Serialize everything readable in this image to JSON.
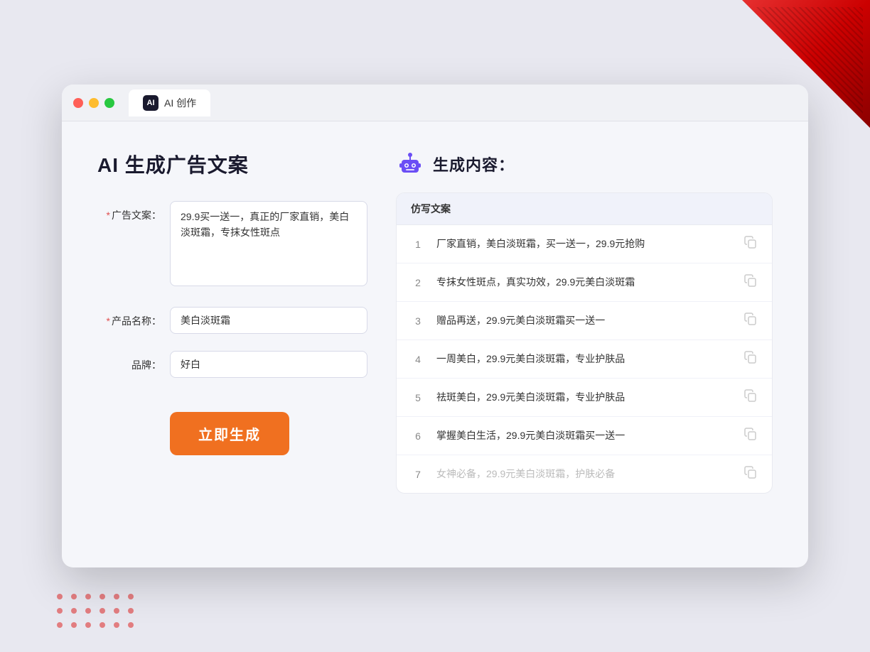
{
  "window": {
    "tab_label": "AI 创作",
    "traffic_lights": [
      "red",
      "yellow",
      "green"
    ]
  },
  "left_panel": {
    "page_title": "AI  生成广告文案",
    "form": {
      "ad_copy_label": "广告文案：",
      "ad_copy_required": "＊",
      "ad_copy_value": "29.9买一送一，真正的厂家直销，美白淡斑霜，专抹女性斑点",
      "product_name_label": "产品名称：",
      "product_name_required": "＊",
      "product_name_value": "美白淡斑霜",
      "brand_label": "品牌：",
      "brand_value": "好白",
      "generate_btn": "立即生成"
    }
  },
  "right_panel": {
    "title": "生成内容：",
    "table_header": "仿写文案",
    "results": [
      {
        "num": "1",
        "text": "厂家直销，美白淡斑霜，买一送一，29.9元抢购",
        "muted": false
      },
      {
        "num": "2",
        "text": "专抹女性斑点，真实功效，29.9元美白淡斑霜",
        "muted": false
      },
      {
        "num": "3",
        "text": "赠品再送，29.9元美白淡斑霜买一送一",
        "muted": false
      },
      {
        "num": "4",
        "text": "一周美白，29.9元美白淡斑霜，专业护肤品",
        "muted": false
      },
      {
        "num": "5",
        "text": "祛斑美白，29.9元美白淡斑霜，专业护肤品",
        "muted": false
      },
      {
        "num": "6",
        "text": "掌握美白生活，29.9元美白淡斑霜买一送一",
        "muted": false
      },
      {
        "num": "7",
        "text": "女神必备，29.9元美白淡斑霜，护肤必备",
        "muted": true
      }
    ]
  }
}
